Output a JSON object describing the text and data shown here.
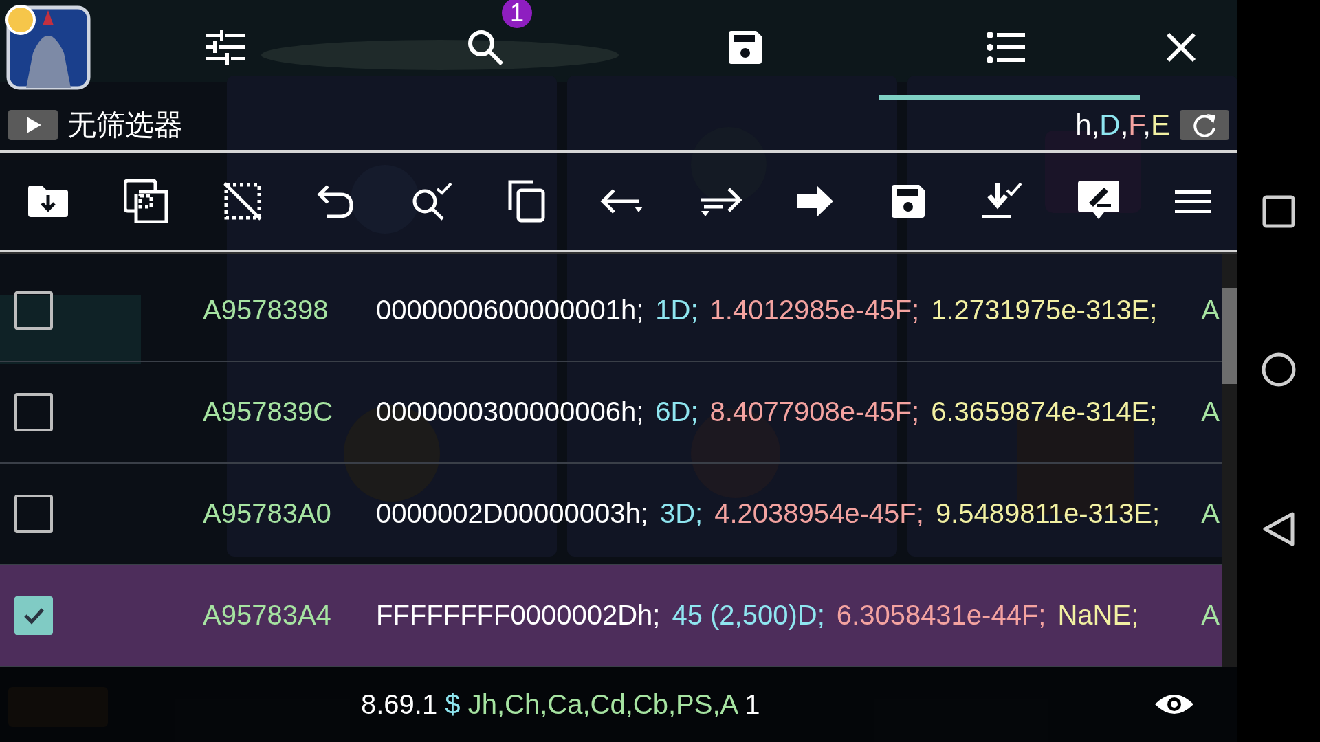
{
  "header": {
    "badge": "1"
  },
  "filter": {
    "label": "无筛选器"
  },
  "type_flags": [
    {
      "text": "h",
      "kind": "hex"
    },
    {
      "text": ",",
      "kind": "sep"
    },
    {
      "text": "D",
      "kind": "dword"
    },
    {
      "text": ",",
      "kind": "sep"
    },
    {
      "text": "F",
      "kind": "float"
    },
    {
      "text": ",",
      "kind": "sep"
    },
    {
      "text": "E",
      "kind": "double"
    }
  ],
  "results": [
    {
      "address": "A9578398",
      "checked": false,
      "values": [
        {
          "text": "0000000600000001h;",
          "kind": "hex"
        },
        {
          "text": "1D;",
          "kind": "dword"
        },
        {
          "text": "1.4012985e-45F;",
          "kind": "float"
        },
        {
          "text": "1.2731975e-313E;",
          "kind": "double"
        },
        {
          "text": "A",
          "kind": "auto"
        }
      ]
    },
    {
      "address": "A957839C",
      "checked": false,
      "values": [
        {
          "text": "0000000300000006h;",
          "kind": "hex"
        },
        {
          "text": "6D;",
          "kind": "dword"
        },
        {
          "text": "8.4077908e-45F;",
          "kind": "float"
        },
        {
          "text": "6.3659874e-314E;",
          "kind": "double"
        },
        {
          "text": "A",
          "kind": "auto"
        }
      ]
    },
    {
      "address": "A95783A0",
      "checked": false,
      "values": [
        {
          "text": "0000002D00000003h;",
          "kind": "hex"
        },
        {
          "text": "3D;",
          "kind": "dword"
        },
        {
          "text": "4.2038954e-45F;",
          "kind": "float"
        },
        {
          "text": "9.5489811e-313E;",
          "kind": "double"
        },
        {
          "text": "A",
          "kind": "auto"
        }
      ]
    },
    {
      "address": "A95783A4",
      "checked": true,
      "values": [
        {
          "text": "FFFFFFFF0000002Dh;",
          "kind": "hex"
        },
        {
          "text": "45 (2,500)D;",
          "kind": "dword"
        },
        {
          "text": "6.3058431e-44F;",
          "kind": "float"
        },
        {
          "text": "NaNE;",
          "kind": "double"
        },
        {
          "text": "A",
          "kind": "auto"
        }
      ]
    }
  ],
  "status_bar": [
    {
      "text": "8.69.1",
      "kind": "hex"
    },
    {
      "text": "$",
      "kind": "dword"
    },
    {
      "text": "Jh,Ch,Ca,Cd,Cb,PS,A",
      "kind": "auto"
    },
    {
      "text": "1",
      "kind": "hex"
    }
  ]
}
